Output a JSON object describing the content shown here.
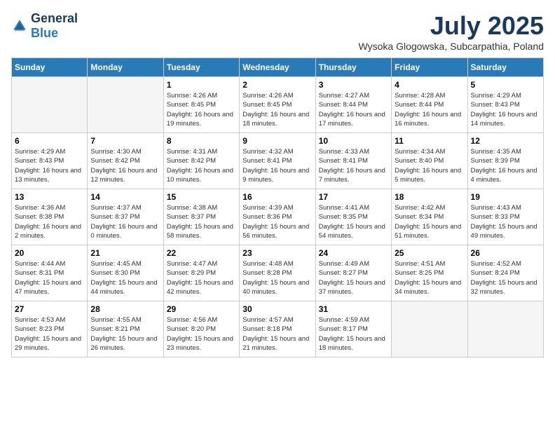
{
  "header": {
    "logo_general": "General",
    "logo_blue": "Blue",
    "title": "July 2025",
    "subtitle": "Wysoka Glogowska, Subcarpathia, Poland"
  },
  "days_of_week": [
    "Sunday",
    "Monday",
    "Tuesday",
    "Wednesday",
    "Thursday",
    "Friday",
    "Saturday"
  ],
  "weeks": [
    [
      {
        "day": "",
        "info": ""
      },
      {
        "day": "",
        "info": ""
      },
      {
        "day": "1",
        "info": "Sunrise: 4:26 AM\nSunset: 8:45 PM\nDaylight: 16 hours\nand 19 minutes."
      },
      {
        "day": "2",
        "info": "Sunrise: 4:26 AM\nSunset: 8:45 PM\nDaylight: 16 hours\nand 18 minutes."
      },
      {
        "day": "3",
        "info": "Sunrise: 4:27 AM\nSunset: 8:44 PM\nDaylight: 16 hours\nand 17 minutes."
      },
      {
        "day": "4",
        "info": "Sunrise: 4:28 AM\nSunset: 8:44 PM\nDaylight: 16 hours\nand 16 minutes."
      },
      {
        "day": "5",
        "info": "Sunrise: 4:29 AM\nSunset: 8:43 PM\nDaylight: 16 hours\nand 14 minutes."
      }
    ],
    [
      {
        "day": "6",
        "info": "Sunrise: 4:29 AM\nSunset: 8:43 PM\nDaylight: 16 hours\nand 13 minutes."
      },
      {
        "day": "7",
        "info": "Sunrise: 4:30 AM\nSunset: 8:42 PM\nDaylight: 16 hours\nand 12 minutes."
      },
      {
        "day": "8",
        "info": "Sunrise: 4:31 AM\nSunset: 8:42 PM\nDaylight: 16 hours\nand 10 minutes."
      },
      {
        "day": "9",
        "info": "Sunrise: 4:32 AM\nSunset: 8:41 PM\nDaylight: 16 hours\nand 9 minutes."
      },
      {
        "day": "10",
        "info": "Sunrise: 4:33 AM\nSunset: 8:41 PM\nDaylight: 16 hours\nand 7 minutes."
      },
      {
        "day": "11",
        "info": "Sunrise: 4:34 AM\nSunset: 8:40 PM\nDaylight: 16 hours\nand 5 minutes."
      },
      {
        "day": "12",
        "info": "Sunrise: 4:35 AM\nSunset: 8:39 PM\nDaylight: 16 hours\nand 4 minutes."
      }
    ],
    [
      {
        "day": "13",
        "info": "Sunrise: 4:36 AM\nSunset: 8:38 PM\nDaylight: 16 hours\nand 2 minutes."
      },
      {
        "day": "14",
        "info": "Sunrise: 4:37 AM\nSunset: 8:37 PM\nDaylight: 16 hours\nand 0 minutes."
      },
      {
        "day": "15",
        "info": "Sunrise: 4:38 AM\nSunset: 8:37 PM\nDaylight: 15 hours\nand 58 minutes."
      },
      {
        "day": "16",
        "info": "Sunrise: 4:39 AM\nSunset: 8:36 PM\nDaylight: 15 hours\nand 56 minutes."
      },
      {
        "day": "17",
        "info": "Sunrise: 4:41 AM\nSunset: 8:35 PM\nDaylight: 15 hours\nand 54 minutes."
      },
      {
        "day": "18",
        "info": "Sunrise: 4:42 AM\nSunset: 8:34 PM\nDaylight: 15 hours\nand 51 minutes."
      },
      {
        "day": "19",
        "info": "Sunrise: 4:43 AM\nSunset: 8:33 PM\nDaylight: 15 hours\nand 49 minutes."
      }
    ],
    [
      {
        "day": "20",
        "info": "Sunrise: 4:44 AM\nSunset: 8:31 PM\nDaylight: 15 hours\nand 47 minutes."
      },
      {
        "day": "21",
        "info": "Sunrise: 4:45 AM\nSunset: 8:30 PM\nDaylight: 15 hours\nand 44 minutes."
      },
      {
        "day": "22",
        "info": "Sunrise: 4:47 AM\nSunset: 8:29 PM\nDaylight: 15 hours\nand 42 minutes."
      },
      {
        "day": "23",
        "info": "Sunrise: 4:48 AM\nSunset: 8:28 PM\nDaylight: 15 hours\nand 40 minutes."
      },
      {
        "day": "24",
        "info": "Sunrise: 4:49 AM\nSunset: 8:27 PM\nDaylight: 15 hours\nand 37 minutes."
      },
      {
        "day": "25",
        "info": "Sunrise: 4:51 AM\nSunset: 8:25 PM\nDaylight: 15 hours\nand 34 minutes."
      },
      {
        "day": "26",
        "info": "Sunrise: 4:52 AM\nSunset: 8:24 PM\nDaylight: 15 hours\nand 32 minutes."
      }
    ],
    [
      {
        "day": "27",
        "info": "Sunrise: 4:53 AM\nSunset: 8:23 PM\nDaylight: 15 hours\nand 29 minutes."
      },
      {
        "day": "28",
        "info": "Sunrise: 4:55 AM\nSunset: 8:21 PM\nDaylight: 15 hours\nand 26 minutes."
      },
      {
        "day": "29",
        "info": "Sunrise: 4:56 AM\nSunset: 8:20 PM\nDaylight: 15 hours\nand 23 minutes."
      },
      {
        "day": "30",
        "info": "Sunrise: 4:57 AM\nSunset: 8:18 PM\nDaylight: 15 hours\nand 21 minutes."
      },
      {
        "day": "31",
        "info": "Sunrise: 4:59 AM\nSunset: 8:17 PM\nDaylight: 15 hours\nand 18 minutes."
      },
      {
        "day": "",
        "info": ""
      },
      {
        "day": "",
        "info": ""
      }
    ]
  ]
}
